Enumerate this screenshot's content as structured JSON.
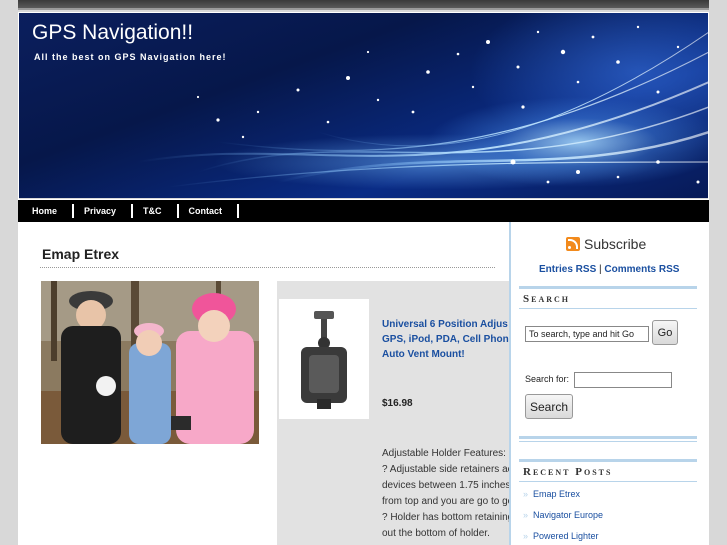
{
  "site": {
    "title": "GPS Navigation!!",
    "tagline": "All the best on GPS Navigation here!"
  },
  "nav": {
    "items": [
      "Home",
      "Privacy",
      "T&C",
      "Contact"
    ]
  },
  "post": {
    "title": "Emap Etrex",
    "product": {
      "link_lines": [
        "Universal 6 Position Adjus",
        "GPS, iPod, PDA, Cell Phon",
        "Auto Vent Mount!"
      ],
      "price": "$16.98",
      "feature_lines": [
        "Adjustable Holder Features:",
        "? Adjustable side retainers ac",
        "devices between 1.75 inches",
        "from top and you are go to go",
        "? Holder has bottom retaining",
        "out the bottom of holder."
      ]
    }
  },
  "sidebar": {
    "subscribe_label": "Subscribe",
    "entries_rss": "Entries RSS",
    "separator": "|",
    "comments_rss": "Comments RSS",
    "search_heading": "Search",
    "search_value": "To search, type and hit Go",
    "go_label": "Go",
    "search_for_label": "Search for:",
    "search_button": "Search",
    "recent_heading": "Recent Posts",
    "recent_posts": [
      "Emap Etrex",
      "Navigator Europe",
      "Powered Lighter"
    ]
  },
  "colors": {
    "link": "#1a4fa0",
    "nav_bg": "#000000",
    "accent_rule": "#b8d4ea",
    "rss": "#f28a1c"
  }
}
